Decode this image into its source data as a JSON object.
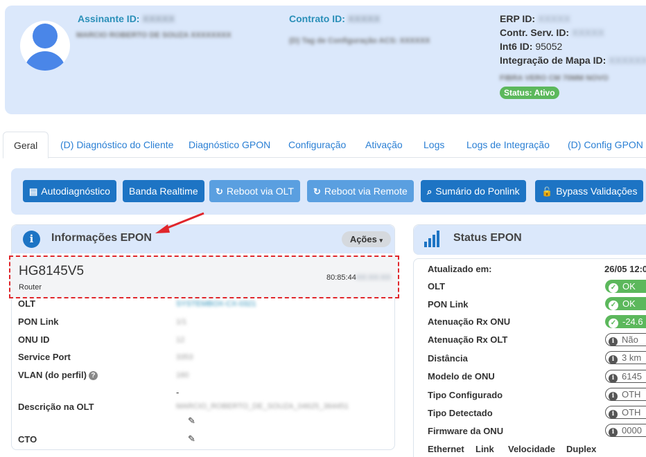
{
  "header": {
    "assinante_label": "Assinante ID:",
    "assinante_value": "XXXXX",
    "assinante_name": "MARCIO ROBERTO DE SOUZA XXXXXXXX",
    "contrato_label": "Contrato ID:",
    "contrato_value": "XXXXX",
    "tag_config": "(D) Tag de Configuração ACS: XXXXXX",
    "erp_label": "ERP ID:",
    "erp_value": "XXXXX",
    "contr_serv_label": "Contr. Serv. ID:",
    "contr_serv_value": "XXXXX",
    "int6_label": "Int6 ID:",
    "int6_value": "95052",
    "mapa_label": "Integração de Mapa ID:",
    "mapa_value": "XXXXXX",
    "plan_blur": "FIBRA VERO CM 70MM NOVO",
    "status": "Status: Ativo"
  },
  "tabs": [
    "Geral",
    "(D) Diagnóstico do Cliente",
    "Diagnóstico GPON",
    "Configuração",
    "Ativação",
    "Logs",
    "Logs de Integração",
    "(D) Config GPON e"
  ],
  "toolbar": {
    "autodiagnostico": "Autodiagnóstico",
    "banda_realtime": "Banda Realtime",
    "reboot_olt": "Reboot via OLT",
    "reboot_remote": "Reboot via Remote",
    "sumario_ponlink": "Sumário do Ponlink",
    "bypass": "Bypass Validações"
  },
  "epon_info": {
    "title": "Informações EPON",
    "acoes": "Ações",
    "model": "HG8145V5",
    "device_type": "Router",
    "mac_visible": "80:85:44",
    "mac_hidden": "XX:XX:XX",
    "rows": {
      "olt_label": "OLT",
      "olt_value": "SYSTEMBOX-CX-0321",
      "pon_label": "PON Link",
      "pon_value": "1/1",
      "onu_label": "ONU ID",
      "onu_value": "12",
      "service_label": "Service Port",
      "service_value": "3353",
      "vlan_label": "VLAN (do perfil)",
      "vlan_value": "160",
      "desc_label": "Descrição na OLT",
      "desc_dash": "-",
      "desc_value": "MARCIO_ROBERTO_DE_SOUZA_04625_364451",
      "cto_label": "CTO"
    }
  },
  "status_epon": {
    "title": "Status EPON",
    "updated_label": "Atualizado em:",
    "updated_value": "26/05 12:0",
    "olt_label": "OLT",
    "olt_value": "OK",
    "pon_label": "PON Link",
    "pon_value": "OK",
    "rx_onu_label": "Atenuação Rx ONU",
    "rx_onu_value": "-24.6",
    "rx_olt_label": "Atenuação Rx OLT",
    "rx_olt_value": "Não",
    "distancia_label": "Distância",
    "distancia_value": "3 km",
    "modelo_label": "Modelo de ONU",
    "modelo_value": "6145",
    "tipo_conf_label": "Tipo Configurado",
    "tipo_conf_value": "OTH",
    "tipo_det_label": "Tipo Detectado",
    "tipo_det_value": "OTH",
    "firmware_label": "Firmware da ONU",
    "firmware_value": "0000",
    "columns": [
      "Ethernet",
      "Link",
      "Velocidade",
      "Duplex"
    ]
  },
  "colors": {
    "accent": "#1d74c4",
    "header_bg": "#dbe8fb",
    "ok_green": "#5cb85c",
    "highlight_red": "#e0262b"
  }
}
